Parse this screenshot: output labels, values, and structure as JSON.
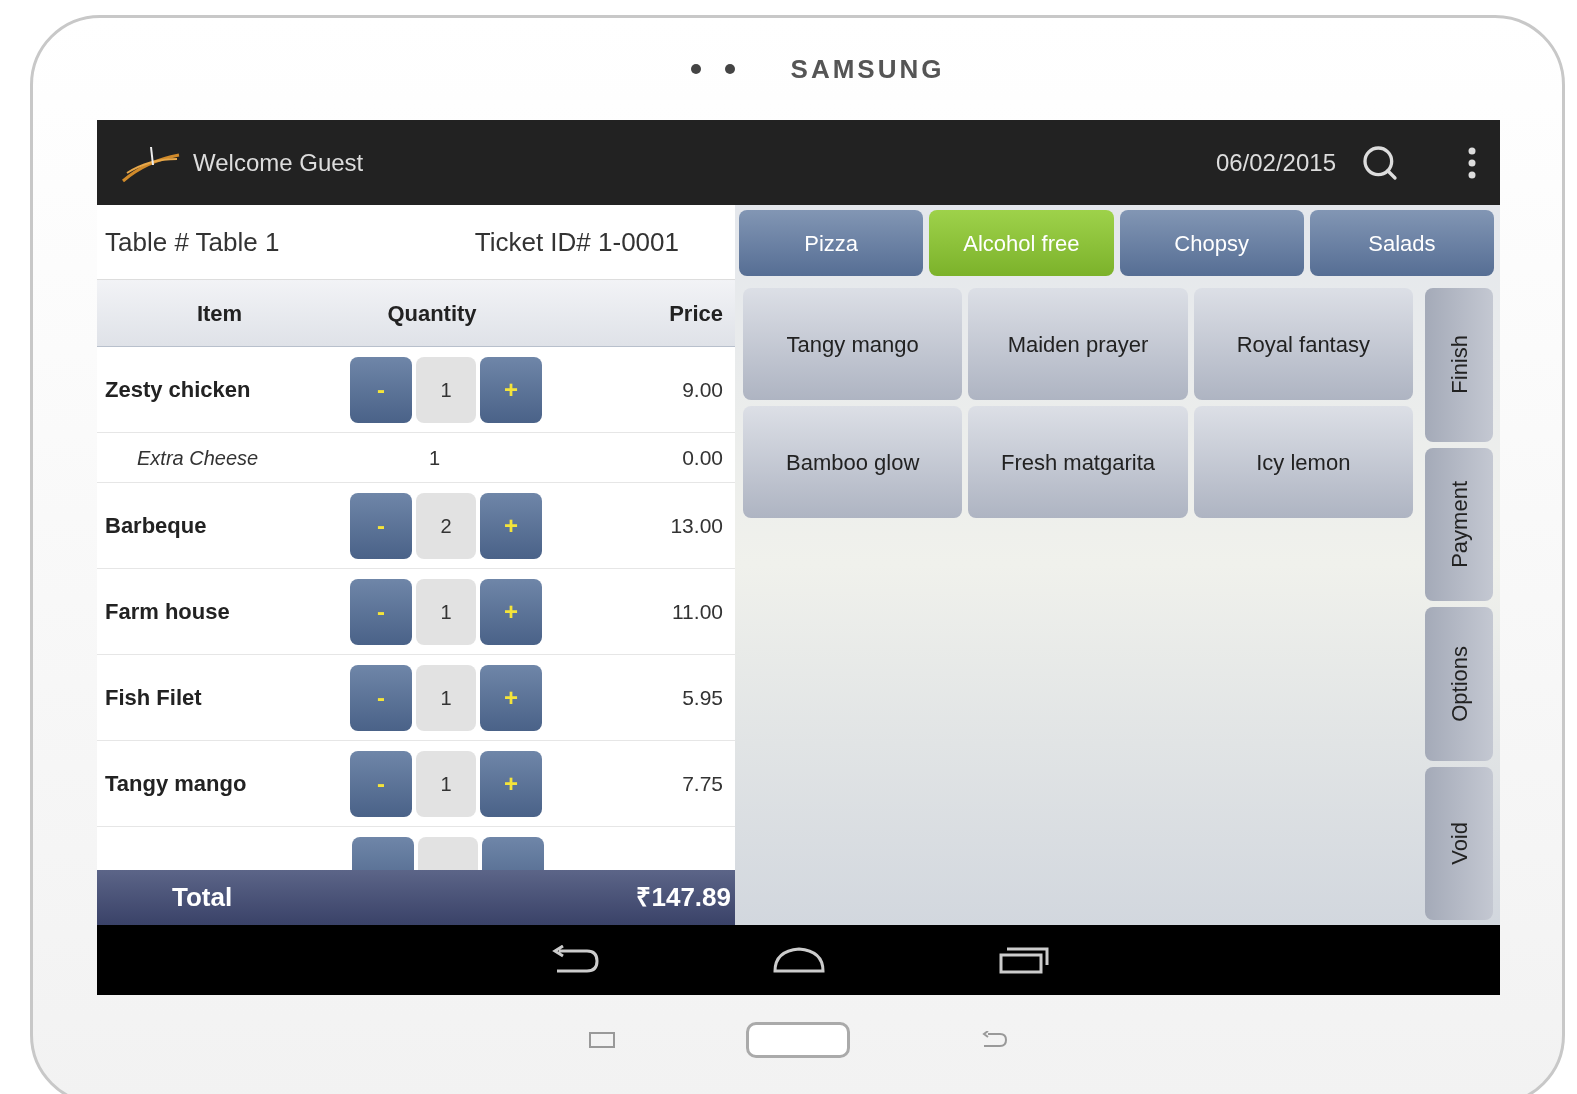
{
  "device": {
    "brand": "SAMSUNG"
  },
  "action_bar": {
    "title": "Welcome Guest",
    "date": "06/02/2015"
  },
  "ticket": {
    "table": "Table # Table 1",
    "ticket_id": "Ticket ID# 1-0001"
  },
  "order": {
    "columns": [
      "Item",
      "Quantity",
      "Price"
    ],
    "rows": [
      {
        "kind": "item",
        "name": "Zesty chicken",
        "minus": "-",
        "quantity": "1",
        "plus": "+",
        "price": "9.00"
      },
      {
        "kind": "modifier",
        "name": "Extra Cheese",
        "quantity": "1",
        "price": "0.00"
      },
      {
        "kind": "item",
        "name": "Barbeque",
        "minus": "-",
        "quantity": "2",
        "plus": "+",
        "price": "13.00"
      },
      {
        "kind": "item",
        "name": "Farm house",
        "minus": "-",
        "quantity": "1",
        "plus": "+",
        "price": "11.00"
      },
      {
        "kind": "item",
        "name": "Fish Filet",
        "minus": "-",
        "quantity": "1",
        "plus": "+",
        "price": "5.95"
      },
      {
        "kind": "item",
        "name": "Tangy mango",
        "minus": "-",
        "quantity": "1",
        "plus": "+",
        "price": "7.75"
      },
      {
        "kind": "partial"
      }
    ],
    "total": {
      "label": "Total",
      "amount": "₹147.89"
    }
  },
  "categories": [
    {
      "label": "Pizza",
      "selected": false
    },
    {
      "label": "Alcohol free",
      "selected": true
    },
    {
      "label": "Chopsy",
      "selected": false
    },
    {
      "label": "Salads",
      "selected": false
    }
  ],
  "products": [
    "Tangy mango",
    "Maiden prayer",
    "Royal fantasy",
    "Bamboo glow",
    "Fresh matgarita",
    "Icy lemon"
  ],
  "actions": [
    "Finish",
    "Payment",
    "Options",
    "Void"
  ]
}
